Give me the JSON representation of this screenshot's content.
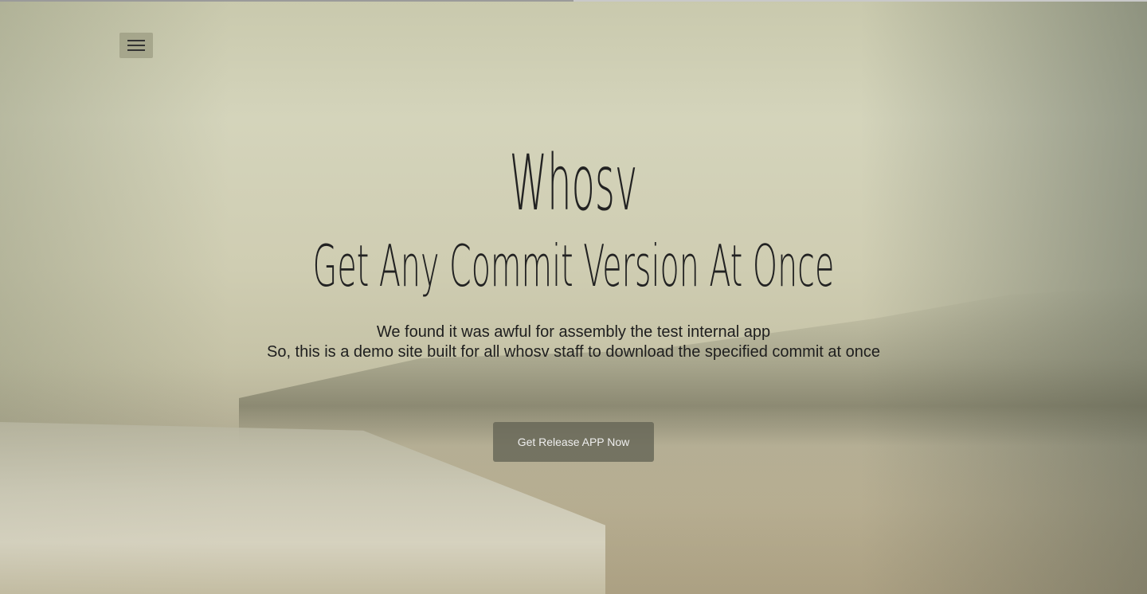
{
  "header": {
    "menu_icon": "hamburger-menu-icon"
  },
  "hero": {
    "title": "Whosv",
    "subtitle": "Get Any Commit Version At Once",
    "description_line1": "We found it was awful for assembly the test internal app",
    "description_line2": "So, this is a demo site built for all whosv staff to download the specified commit at once",
    "cta_label": "Get Release APP Now"
  }
}
